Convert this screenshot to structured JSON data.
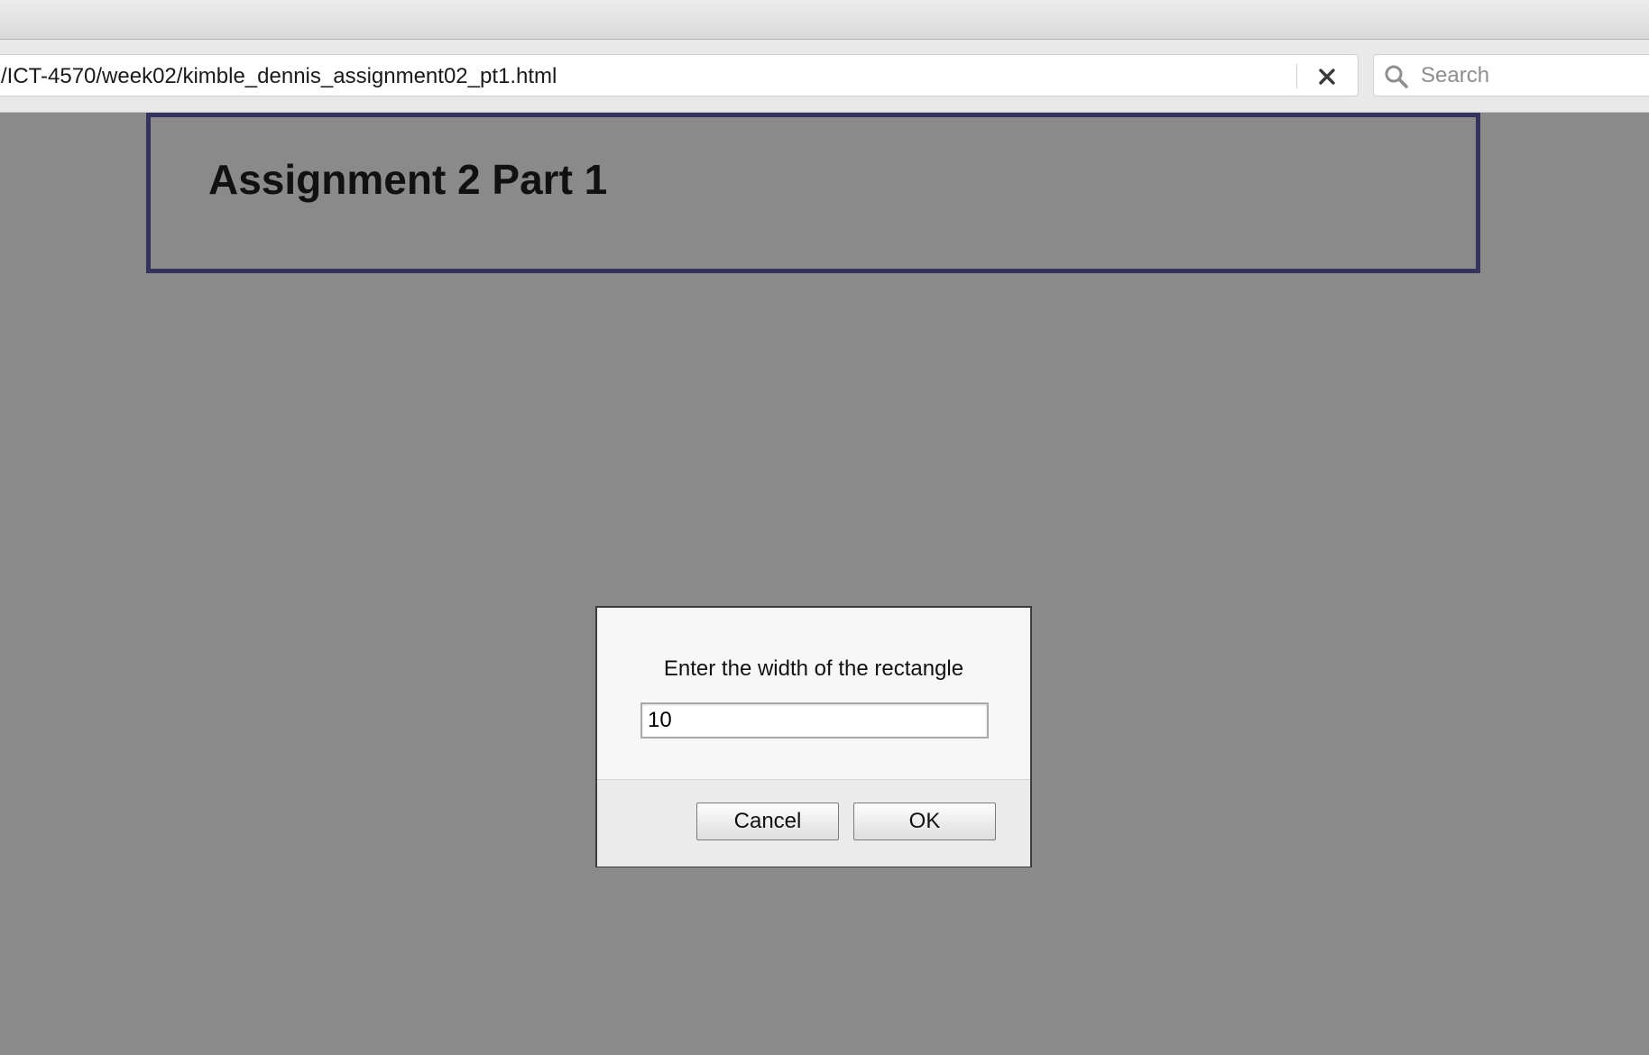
{
  "browser": {
    "url": "/ICT-4570/week02/kimble_dennis_assignment02_pt1.html",
    "search_placeholder": "Search"
  },
  "page": {
    "title": "Assignment 2 Part 1"
  },
  "dialog": {
    "message": "Enter the width of the rectangle",
    "input_value": "10",
    "cancel_label": "Cancel",
    "ok_label": "OK"
  }
}
